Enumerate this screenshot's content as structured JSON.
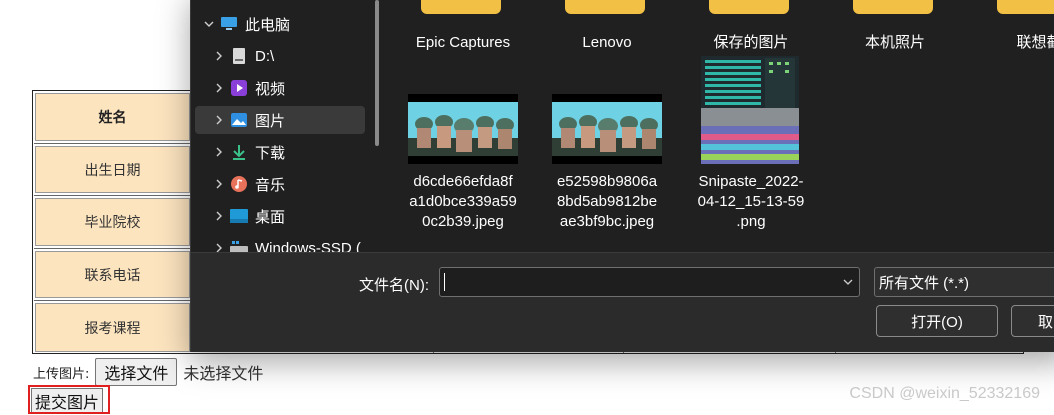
{
  "page": {
    "form_rows": [
      {
        "label": "姓名"
      },
      {
        "label": "出生日期"
      },
      {
        "label": "毕业院校"
      },
      {
        "label": "联系电话"
      },
      {
        "label": "报考课程"
      }
    ],
    "upload_label": "上传图片:",
    "choose_file_button": "选择文件",
    "no_file_text": "未选择文件",
    "submit_button": "提交图片"
  },
  "dialog": {
    "nav": [
      {
        "label": "此电脑",
        "icon": "pc-icon",
        "expanded": true
      },
      {
        "label": "D:\\",
        "icon": "drive-icon"
      },
      {
        "label": "视频",
        "icon": "video-icon"
      },
      {
        "label": "图片",
        "icon": "pictures-icon",
        "selected": true
      },
      {
        "label": "下载",
        "icon": "download-icon"
      },
      {
        "label": "音乐",
        "icon": "music-icon"
      },
      {
        "label": "桌面",
        "icon": "desktop-icon"
      },
      {
        "label": "Windows-SSD (",
        "icon": "windows-drive-icon"
      }
    ],
    "folders": [
      {
        "name": "Epic Captures"
      },
      {
        "name": "Lenovo"
      },
      {
        "name": "保存的图片"
      },
      {
        "name": "本机照片"
      },
      {
        "name": "联想截"
      }
    ],
    "files": [
      {
        "name_lines": [
          "d6cde66efda8f",
          "a1d0bce339a59",
          "0c2b39.jpeg"
        ]
      },
      {
        "name_lines": [
          "e52598b9806a",
          "8bd5ab9812be",
          "ae3bf9bc.jpeg"
        ]
      },
      {
        "name_lines": [
          "Snipaste_2022-",
          "04-12_15-13-59",
          ".png"
        ]
      }
    ],
    "filename_label": "文件名(N):",
    "filename_value": "",
    "file_type_selected": "所有文件 (*.*)",
    "open_button": "打开(O)",
    "cancel_button": "取"
  },
  "watermark": "CSDN @weixin_52332169",
  "colors": {
    "form_label_bg": "#fce4bf",
    "dialog_bg": "#202020",
    "dialog_bottom_bg": "#2b2b2b",
    "folder_yellow": "#f2c044",
    "selected_nav_bg": "#3a3a3a",
    "highlight_red": "#e02020"
  }
}
